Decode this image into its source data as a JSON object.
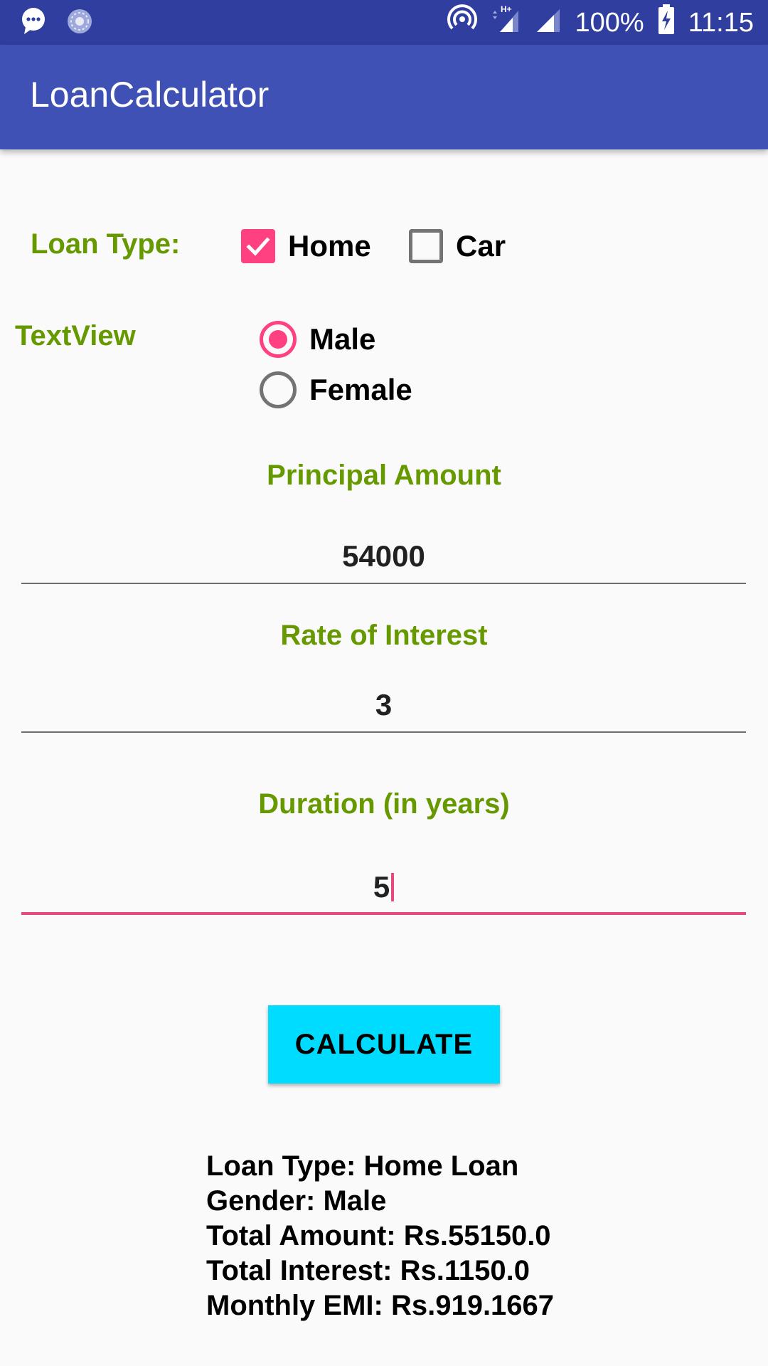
{
  "status_bar": {
    "battery": "100%",
    "time": "11:15",
    "icons": [
      "message-icon",
      "sync-icon",
      "hotspot-icon",
      "signal-hplus-icon",
      "signal-icon",
      "battery-charging-icon"
    ]
  },
  "app_bar": {
    "title": "LoanCalculator"
  },
  "form": {
    "loan_type_label": "Loan Type:",
    "loan_types": [
      {
        "label": "Home",
        "checked": true
      },
      {
        "label": "Car",
        "checked": false
      }
    ],
    "gender_label": "TextView",
    "genders": [
      {
        "label": "Male",
        "selected": true
      },
      {
        "label": "Female",
        "selected": false
      }
    ],
    "principal_label": "Principal Amount",
    "principal_value": "54000",
    "rate_label": "Rate of Interest",
    "rate_value": "3",
    "duration_label": "Duration (in years)",
    "duration_value": "5"
  },
  "calculate_button": "CALCULATE",
  "results": [
    "Loan Type: Home Loan",
    "Gender: Male",
    "Total Amount: Rs.55150.0",
    "Total Interest: Rs.1150.0",
    "Monthly EMI: Rs.919.1667"
  ],
  "colors": {
    "status_bar": "#303f9f",
    "app_bar": "#3f51b5",
    "accent": "#ff4081",
    "label_green": "#669900",
    "button": "#00dcff"
  }
}
